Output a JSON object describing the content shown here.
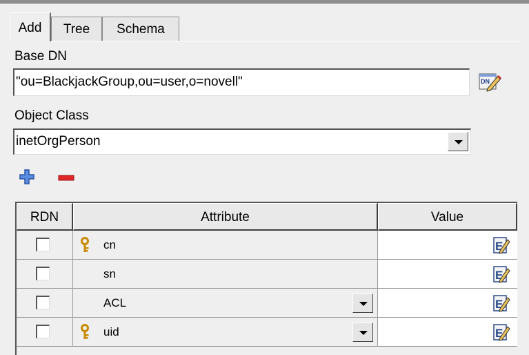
{
  "tabs": [
    {
      "label": "Add",
      "active": true
    },
    {
      "label": "Tree",
      "active": false
    },
    {
      "label": "Schema",
      "active": false
    }
  ],
  "base_dn": {
    "label": "Base DN",
    "value": "\"ou=BlackjackGroup,ou=user,o=novell\"",
    "browse_icon": "dn-browse-icon"
  },
  "object_class": {
    "label": "Object Class",
    "selected": "inetOrgPerson"
  },
  "attribute_actions": {
    "add_icon": "plus-icon",
    "remove_icon": "minus-icon"
  },
  "table": {
    "columns": [
      "RDN",
      "Attribute",
      "Value"
    ],
    "rows": [
      {
        "rdn_checked": false,
        "attribute": "cn",
        "key": true,
        "dropdown": false,
        "value": ""
      },
      {
        "rdn_checked": false,
        "attribute": "sn",
        "key": false,
        "dropdown": false,
        "value": ""
      },
      {
        "rdn_checked": false,
        "attribute": "ACL",
        "key": false,
        "dropdown": true,
        "value": ""
      },
      {
        "rdn_checked": false,
        "attribute": "uid",
        "key": true,
        "dropdown": true,
        "value": ""
      }
    ]
  },
  "colors": {
    "plus": "#3a6fc4",
    "minus": "#d21818",
    "key": "#c88a00"
  }
}
